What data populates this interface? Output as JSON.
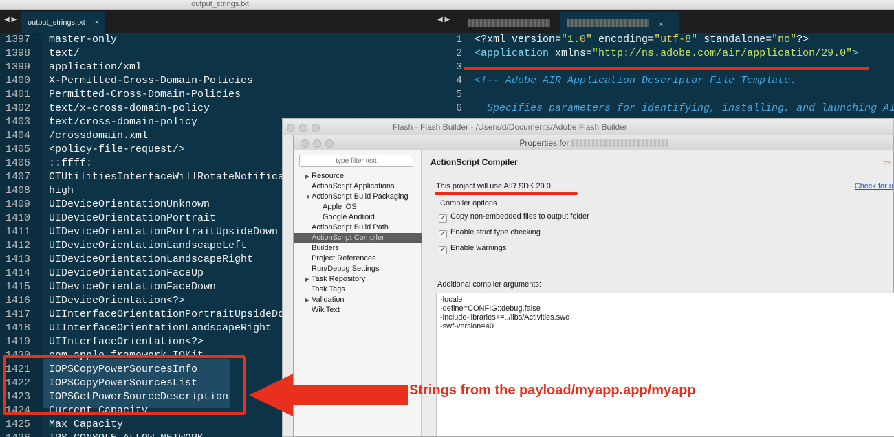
{
  "left_editor": {
    "window_title": "output_strings.txt",
    "tab_label": "output_strings.txt",
    "nav": "◀ ▶",
    "close_glyph": "×",
    "lines": [
      {
        "n": "1397",
        "t": "master-only"
      },
      {
        "n": "1398",
        "t": "text/"
      },
      {
        "n": "1399",
        "t": "application/xml"
      },
      {
        "n": "1400",
        "t": "X-Permitted-Cross-Domain-Policies"
      },
      {
        "n": "1401",
        "t": "Permitted-Cross-Domain-Policies"
      },
      {
        "n": "1402",
        "t": "text/x-cross-domain-policy"
      },
      {
        "n": "1403",
        "t": "text/cross-domain-policy"
      },
      {
        "n": "1404",
        "t": "/crossdomain.xml"
      },
      {
        "n": "1405",
        "t": "<policy-file-request/>"
      },
      {
        "n": "1406",
        "t": "::ffff:"
      },
      {
        "n": "1407",
        "t": "CTUtilitiesInterfaceWillRotateNotifica"
      },
      {
        "n": "1408",
        "t": "high"
      },
      {
        "n": "1409",
        "t": "UIDeviceOrientationUnknown"
      },
      {
        "n": "1410",
        "t": "UIDeviceOrientationPortrait"
      },
      {
        "n": "1411",
        "t": "UIDeviceOrientationPortraitUpsideDown"
      },
      {
        "n": "1412",
        "t": "UIDeviceOrientationLandscapeLeft"
      },
      {
        "n": "1413",
        "t": "UIDeviceOrientationLandscapeRight"
      },
      {
        "n": "1414",
        "t": "UIDeviceOrientationFaceUp"
      },
      {
        "n": "1415",
        "t": "UIDeviceOrientationFaceDown"
      },
      {
        "n": "1416",
        "t": "UIDeviceOrientation<?>"
      },
      {
        "n": "1417",
        "t": "UIInterfaceOrientationPortraitUpsideDo"
      },
      {
        "n": "1418",
        "t": "UIInterfaceOrientationLandscapeRight"
      },
      {
        "n": "1419",
        "t": "UIInterfaceOrientation<?>"
      },
      {
        "n": "1420",
        "t": "com.apple.framework.IOKit"
      },
      {
        "n": "1421",
        "t": "IOPSCopyPowerSourcesInfo"
      },
      {
        "n": "1422",
        "t": "IOPSCopyPowerSourcesList"
      },
      {
        "n": "1423",
        "t": "IOPSGetPowerSourceDescription"
      },
      {
        "n": "1424",
        "t": "Current Capacity"
      },
      {
        "n": "1425",
        "t": "Max Capacity"
      },
      {
        "n": "1426",
        "t": "IPS_CONSOLE_ALLOW_NETWORK"
      }
    ]
  },
  "right_editor": {
    "nav": "◀ ▶",
    "close_glyph": "×",
    "lines": [
      {
        "n": "1",
        "parts": [
          [
            "c-plain",
            "<?xml version="
          ],
          [
            "c-str",
            "\"1.0\""
          ],
          [
            "c-plain",
            " encoding="
          ],
          [
            "c-str",
            "\"utf-8\""
          ],
          [
            "c-plain",
            " standalone="
          ],
          [
            "c-str",
            "\"no\""
          ],
          [
            "c-plain",
            "?>"
          ]
        ]
      },
      {
        "n": "2",
        "parts": [
          [
            "c-tag",
            "<application"
          ],
          [
            "c-plain",
            " xmlns="
          ],
          [
            "c-url",
            "\"http://ns.adobe.com/air/application/29.0\""
          ],
          [
            "c-tag",
            ">"
          ]
        ]
      },
      {
        "n": "3",
        "parts": []
      },
      {
        "n": "4",
        "parts": [
          [
            "c-comment",
            "<!-- Adobe AIR Application Descriptor File Template."
          ]
        ]
      },
      {
        "n": "5",
        "parts": []
      },
      {
        "n": "6",
        "parts": [
          [
            "c-comment",
            "  Specifies parameters for identifying, installing, and launching AI"
          ]
        ]
      }
    ]
  },
  "flash_builder": {
    "title": "Flash - Flash Builder - /Users/d/Documents/Adobe Flash Builder"
  },
  "properties": {
    "title_prefix": "Properties for",
    "filter_placeholder": "type filter text",
    "nav": [
      {
        "label": "Resource",
        "expander": "▶",
        "indent": 0
      },
      {
        "label": "ActionScript Applications",
        "expander": "",
        "indent": 0
      },
      {
        "label": "ActionScript Build Packaging",
        "expander": "▼",
        "indent": 0
      },
      {
        "label": "Apple iOS",
        "expander": "",
        "indent": 1
      },
      {
        "label": "Google Android",
        "expander": "",
        "indent": 1
      },
      {
        "label": "ActionScript Build Path",
        "expander": "",
        "indent": 0
      },
      {
        "label": "ActionScript Compiler",
        "expander": "",
        "indent": 0,
        "selected": true
      },
      {
        "label": "Builders",
        "expander": "",
        "indent": 0
      },
      {
        "label": "Project References",
        "expander": "",
        "indent": 0
      },
      {
        "label": "Run/Debug Settings",
        "expander": "",
        "indent": 0
      },
      {
        "label": "Task Repository",
        "expander": "▶",
        "indent": 0
      },
      {
        "label": "Task Tags",
        "expander": "",
        "indent": 0
      },
      {
        "label": "Validation",
        "expander": "▶",
        "indent": 0
      },
      {
        "label": "WikiText",
        "expander": "",
        "indent": 0
      }
    ],
    "page_title": "ActionScript Compiler",
    "back_icon": "⇦",
    "sdk_note": "This project will use AIR SDK 29.0",
    "check_link": "Check for u",
    "group_label": "Compiler options",
    "checkboxes": [
      {
        "label": "Copy non-embedded files to output folder",
        "checked": true
      },
      {
        "label": "Enable strict type checking",
        "checked": true
      },
      {
        "label": "Enable warnings",
        "checked": true
      }
    ],
    "check_glyph": "✓",
    "args_label": "Additional compiler arguments:",
    "args": "-locale\n-define=CONFIG::debug,false\n-include-libraries+=../libs/Activities.swc\n-swf-version=40"
  },
  "annotation": {
    "callout": "Strings from the payload/myapp.app/myapp",
    "color": "#e8301c"
  }
}
